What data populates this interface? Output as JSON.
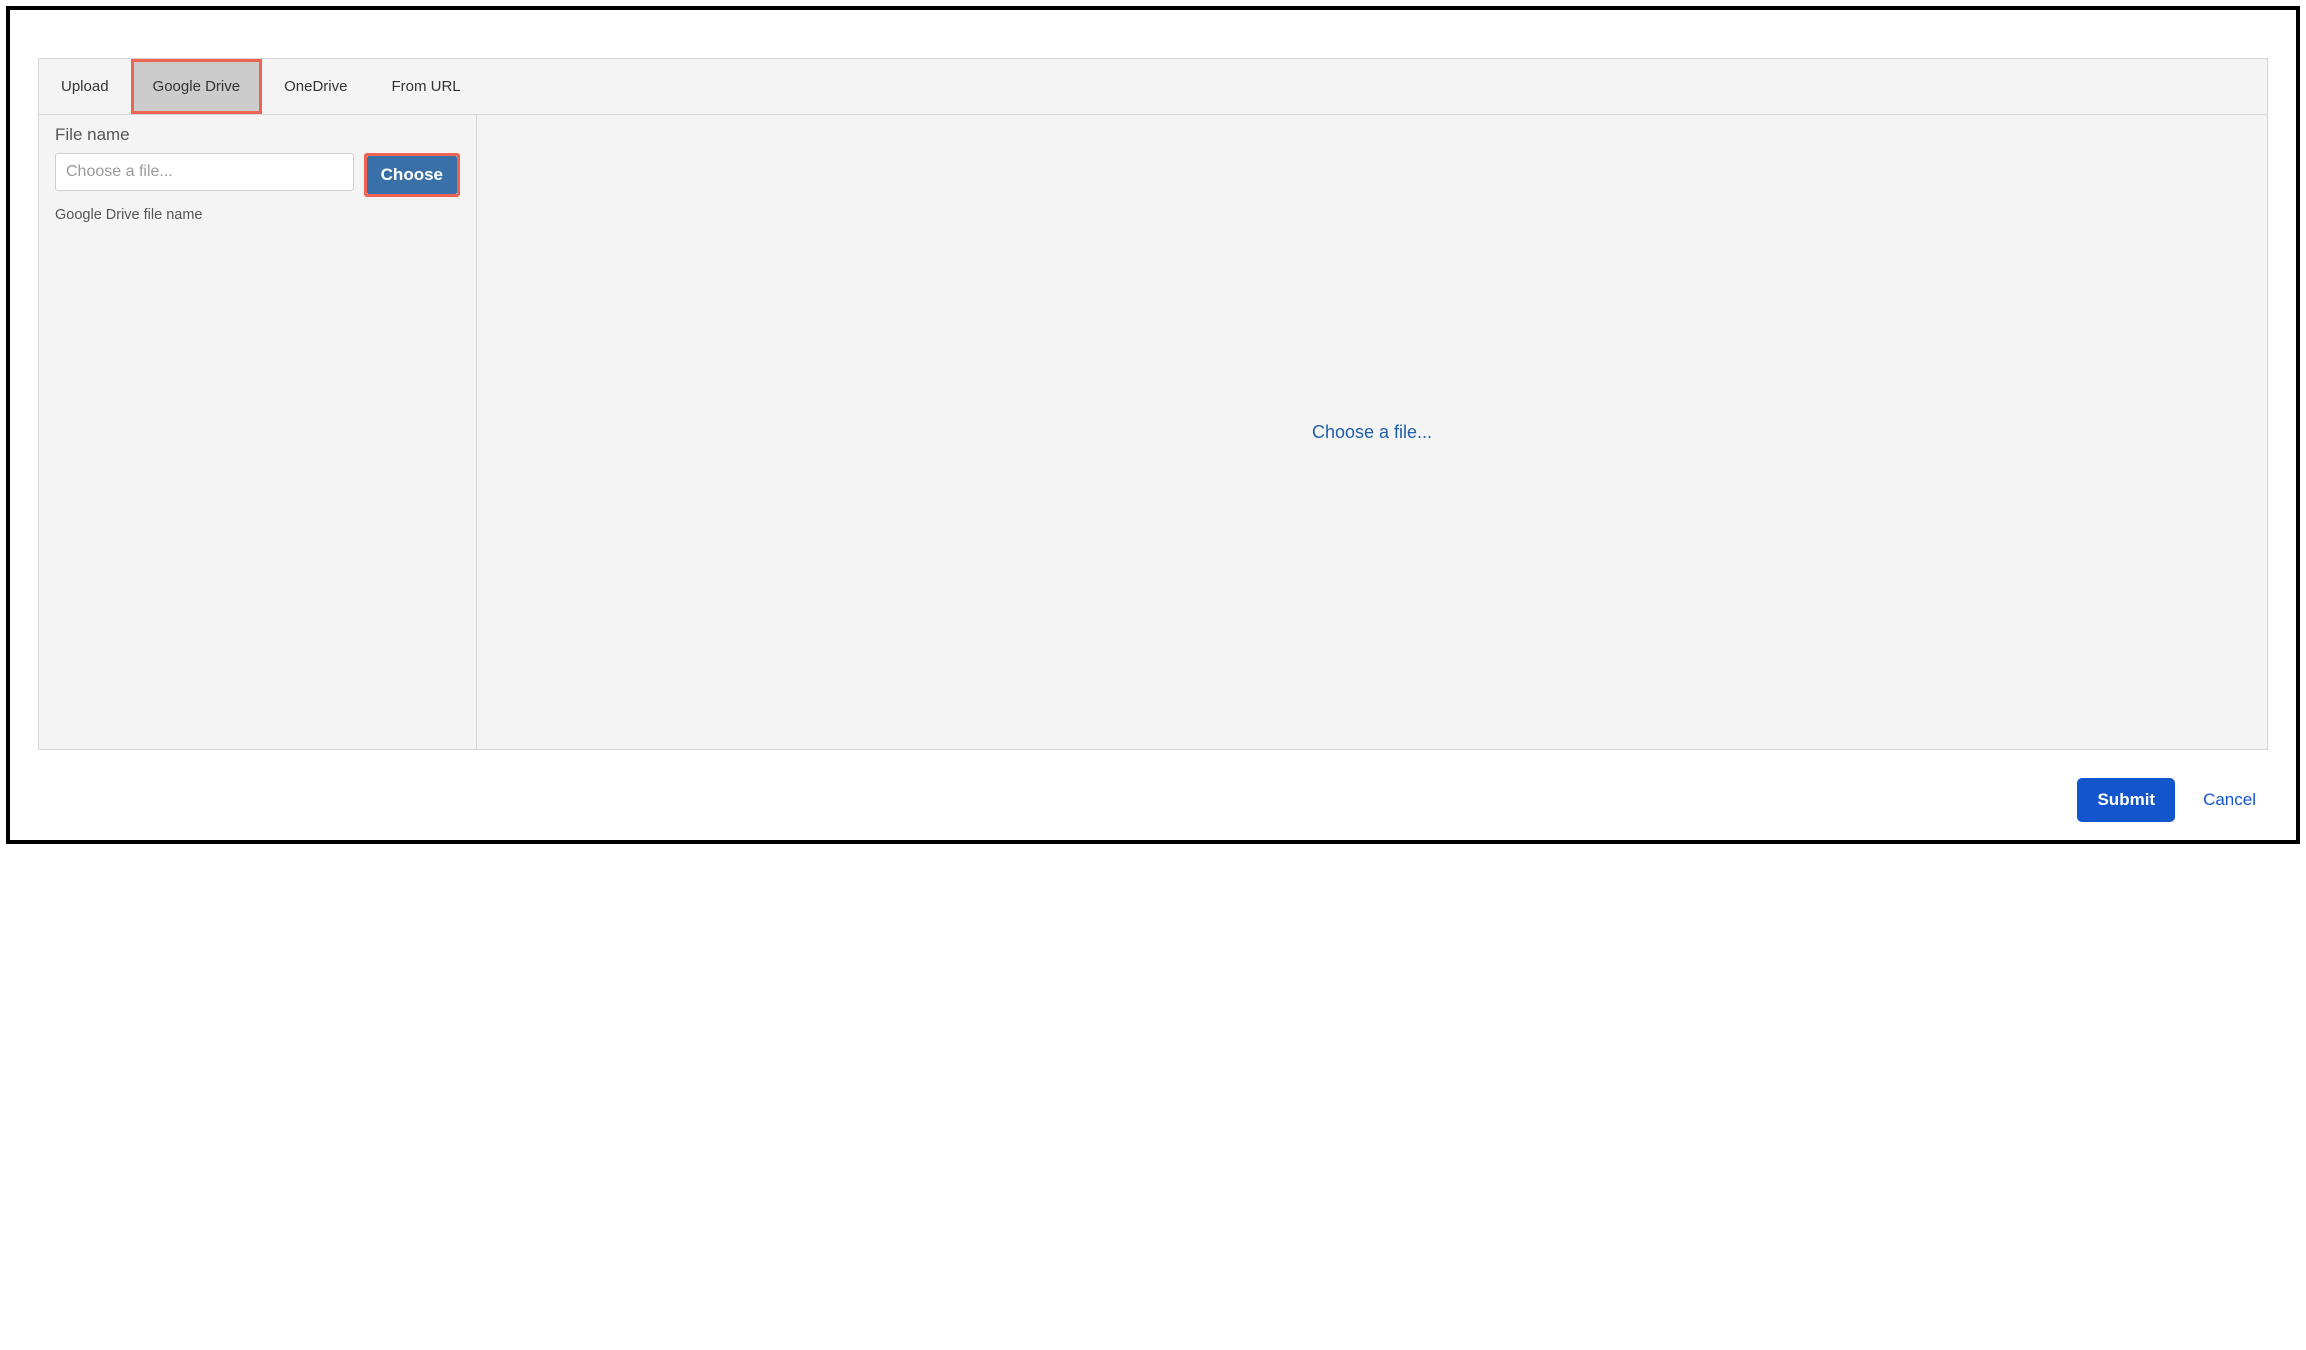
{
  "tabs": [
    {
      "label": "Upload",
      "active": false,
      "highlighted": false
    },
    {
      "label": "Google Drive",
      "active": true,
      "highlighted": true
    },
    {
      "label": "OneDrive",
      "active": false,
      "highlighted": false
    },
    {
      "label": "From URL",
      "active": false,
      "highlighted": false
    }
  ],
  "left": {
    "field_label": "File name",
    "input_placeholder": "Choose a file...",
    "choose_label": "Choose",
    "helper_text": "Google Drive file name"
  },
  "preview": {
    "placeholder": "Choose a file..."
  },
  "footer": {
    "submit_label": "Submit",
    "cancel_label": "Cancel"
  }
}
